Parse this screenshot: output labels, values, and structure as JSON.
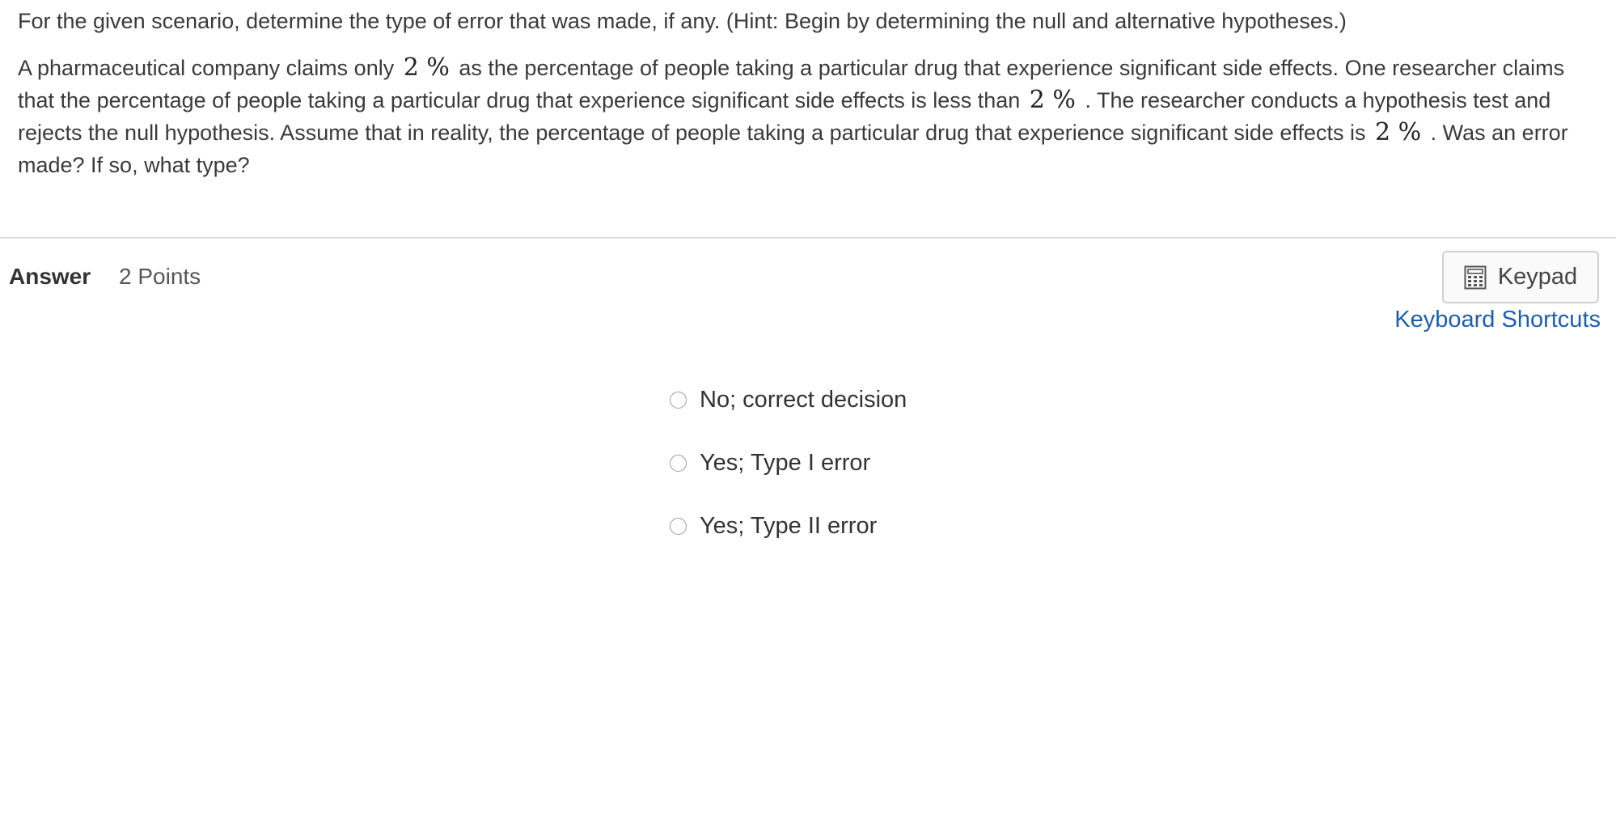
{
  "question": {
    "instruction": "For the given scenario, determine the type of error that was made, if any. (Hint: Begin by determining the null and alternative hypotheses.)",
    "scenario": {
      "part1": "A pharmaceutical company claims only",
      "value1": "2 %",
      "part2": " as the percentage of people taking a particular drug that experience significant side effects. One researcher claims that the percentage of people taking a particular drug that experience significant side effects is less than",
      "value2": "2 %",
      "part3": ". The researcher conducts a hypothesis test and rejects the null hypothesis. Assume that in reality, the percentage of people taking a particular drug that experience significant side effects is",
      "value3": "2 %",
      "part4": ". Was an error made? If so, what type?"
    }
  },
  "answer": {
    "label": "Answer",
    "points": "2 Points"
  },
  "toolbar": {
    "keypad_label": "Keypad",
    "keypad_icon": "calculator-icon",
    "shortcuts_label": "Keyboard Shortcuts"
  },
  "options": [
    {
      "label": "No; correct decision",
      "selected": false
    },
    {
      "label": "Yes; Type I error",
      "selected": false
    },
    {
      "label": "Yes; Type II error",
      "selected": false
    }
  ],
  "colors": {
    "link": "#1f5fa8",
    "text": "#333333",
    "divider": "#dddddd"
  }
}
